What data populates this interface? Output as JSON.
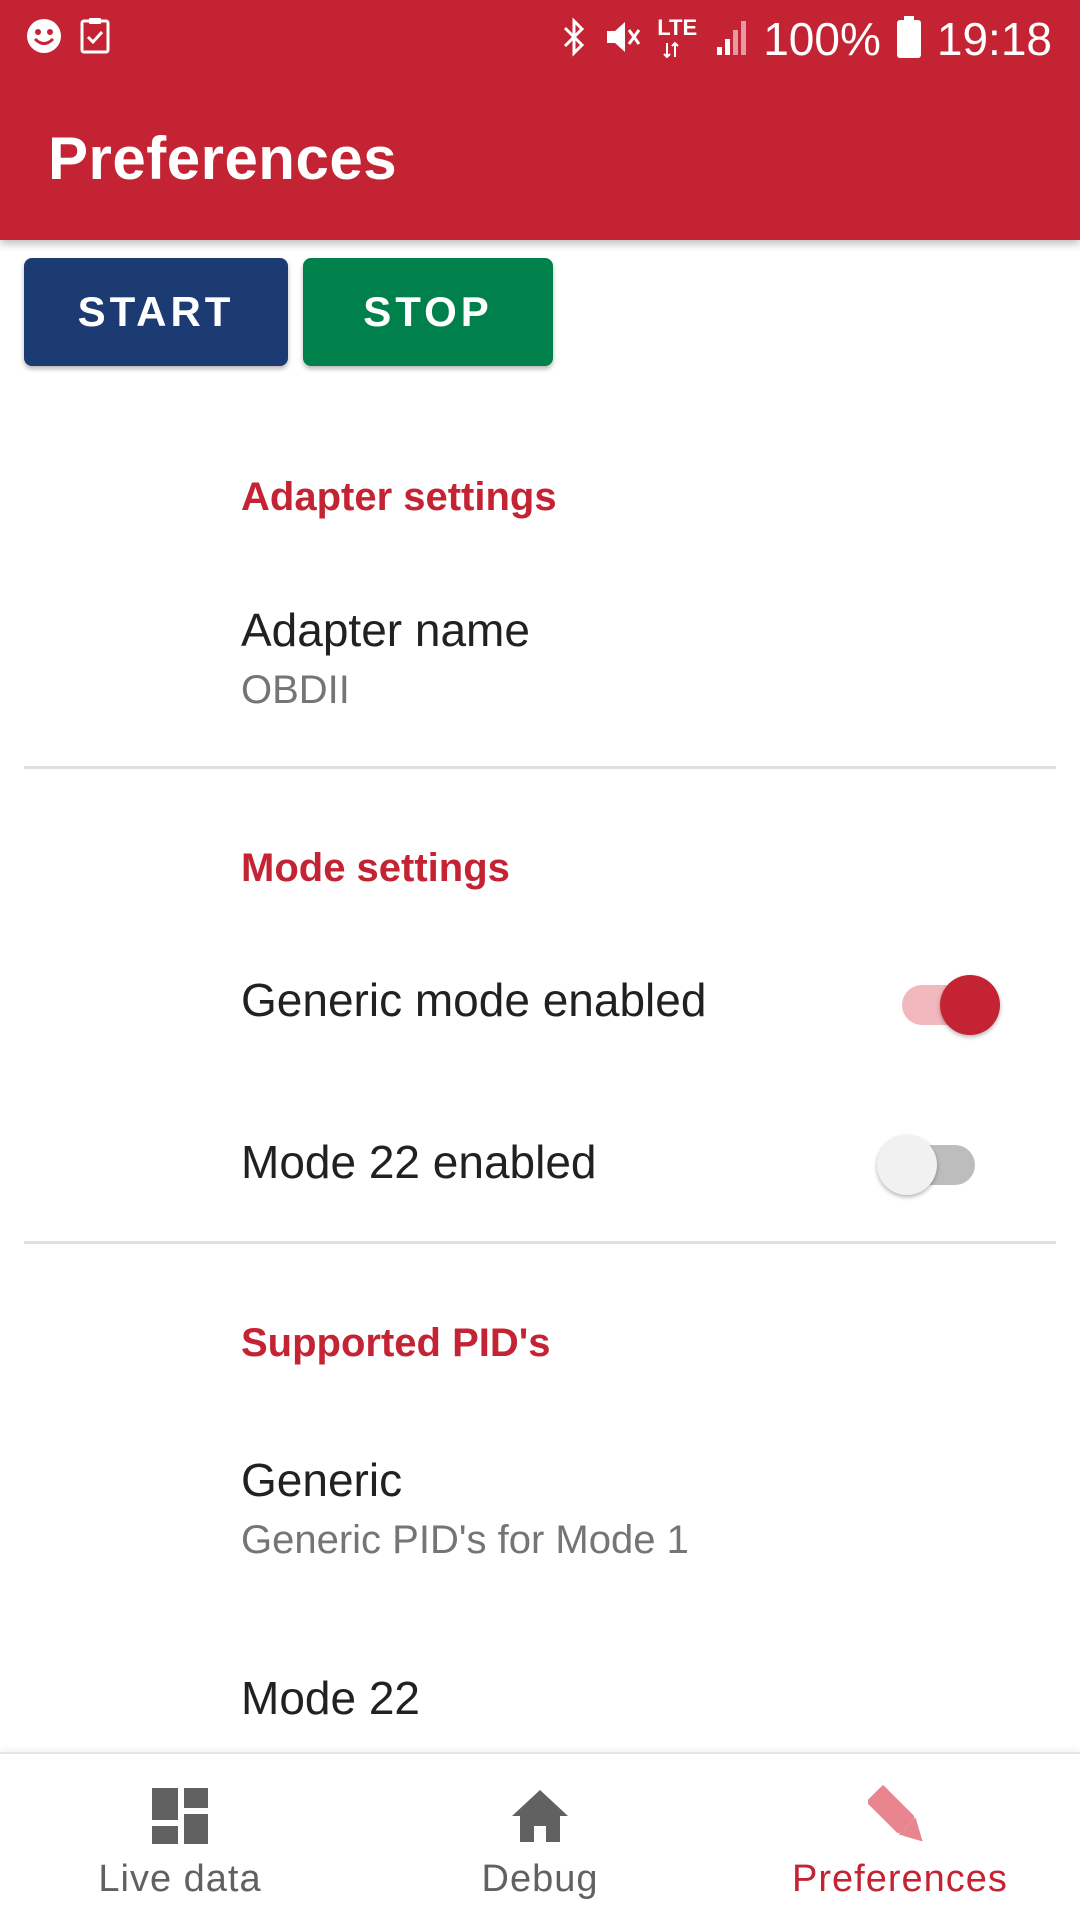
{
  "status_bar": {
    "icons_left": [
      "smiley-notification-icon",
      "clipboard-check-notification-icon"
    ],
    "icons_right": [
      "bluetooth-icon",
      "mute-icon",
      "lte-signal-icon",
      "battery-icon"
    ],
    "network_label": "LTE",
    "battery": "100%",
    "time": "19:18"
  },
  "app_bar": {
    "title": "Preferences",
    "color": "#c42333"
  },
  "controls": {
    "start_label": "START",
    "stop_label": "STOP",
    "start_color": "#1c3b73",
    "stop_color": "#00804a"
  },
  "preferences": {
    "adapter": {
      "header": "Adapter settings",
      "name_title": "Adapter name",
      "name_value": "OBDII"
    },
    "mode": {
      "header": "Mode settings",
      "generic_label": "Generic mode enabled",
      "generic_enabled": true,
      "mode22_label": "Mode 22 enabled",
      "mode22_enabled": false
    },
    "pids": {
      "header": "Supported PID's",
      "generic_title": "Generic",
      "generic_summary": "Generic PID's for Mode 1",
      "mode22_title": "Mode 22"
    }
  },
  "bottom_nav": {
    "items": [
      {
        "label": "Live data",
        "icon": "dashboard-icon",
        "active": false
      },
      {
        "label": "Debug",
        "icon": "home-icon",
        "active": false
      },
      {
        "label": "Preferences",
        "icon": "pencil-icon",
        "active": true
      }
    ],
    "active_color": "#c42333",
    "inactive_color": "#616161"
  }
}
